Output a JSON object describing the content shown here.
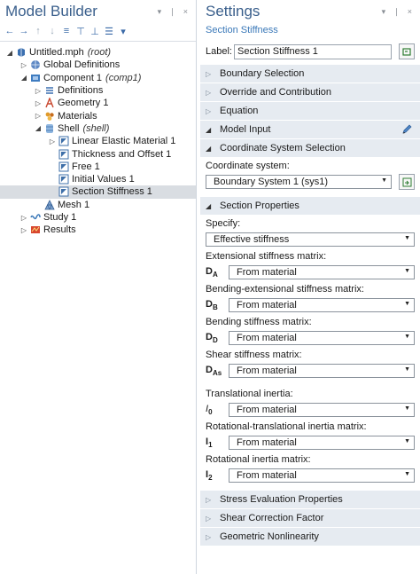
{
  "model_builder": {
    "title": "Model Builder",
    "window_controls": "▾ ❘ ×",
    "toolbar": [
      {
        "name": "back-icon",
        "glyph": "←"
      },
      {
        "name": "forward-icon",
        "glyph": "→"
      },
      {
        "name": "move-up-icon",
        "glyph": "↑"
      },
      {
        "name": "move-down-icon",
        "glyph": "↓"
      },
      {
        "name": "show-icon",
        "glyph": "≡"
      },
      {
        "name": "collapse-icon",
        "glyph": "⊤"
      },
      {
        "name": "expand-icon",
        "glyph": "⊥"
      },
      {
        "name": "list-icon",
        "glyph": "☰"
      },
      {
        "name": "menu-dropdown-icon",
        "glyph": "▾"
      }
    ],
    "tree": [
      {
        "label": "Untitled.mph",
        "em": "(root)",
        "indent": 0,
        "toggle": "◢",
        "icon": "root"
      },
      {
        "label": "Global Definitions",
        "em": "",
        "indent": 1,
        "toggle": "▷",
        "icon": "globe"
      },
      {
        "label": "Component 1",
        "em": "(comp1)",
        "indent": 1,
        "toggle": "◢",
        "icon": "component"
      },
      {
        "label": "Definitions",
        "em": "",
        "indent": 2,
        "toggle": "▷",
        "icon": "definitions"
      },
      {
        "label": "Geometry 1",
        "em": "",
        "indent": 2,
        "toggle": "▷",
        "icon": "geometry"
      },
      {
        "label": "Materials",
        "em": "",
        "indent": 2,
        "toggle": "▷",
        "icon": "materials"
      },
      {
        "label": "Shell",
        "em": "(shell)",
        "indent": 2,
        "toggle": "◢",
        "icon": "shell"
      },
      {
        "label": "Linear Elastic Material 1",
        "em": "",
        "indent": 3,
        "toggle": "▷",
        "icon": "feature"
      },
      {
        "label": "Thickness and Offset 1",
        "em": "",
        "indent": 3,
        "toggle": "",
        "icon": "feature"
      },
      {
        "label": "Free 1",
        "em": "",
        "indent": 3,
        "toggle": "",
        "icon": "feature"
      },
      {
        "label": "Initial Values 1",
        "em": "",
        "indent": 3,
        "toggle": "",
        "icon": "feature"
      },
      {
        "label": "Section Stiffness 1",
        "em": "",
        "indent": 3,
        "toggle": "",
        "icon": "feature",
        "selected": true
      },
      {
        "label": "Mesh 1",
        "em": "",
        "indent": 2,
        "toggle": "",
        "icon": "mesh"
      },
      {
        "label": "Study 1",
        "em": "",
        "indent": 1,
        "toggle": "▷",
        "icon": "study"
      },
      {
        "label": "Results",
        "em": "",
        "indent": 1,
        "toggle": "▷",
        "icon": "results"
      }
    ]
  },
  "settings": {
    "title": "Settings",
    "window_controls": "▾ ❘ ×",
    "subtitle": "Section Stiffness",
    "label_caption": "Label:",
    "label_value": "Section Stiffness 1",
    "sections_top": [
      {
        "title": "Boundary Selection",
        "open": false
      },
      {
        "title": "Override and Contribution",
        "open": false
      },
      {
        "title": "Equation",
        "open": false
      },
      {
        "title": "Model Input",
        "open": true
      }
    ],
    "coord_section": "Coordinate System Selection",
    "coord_label": "Coordinate system:",
    "coord_value": "Boundary System 1 (sys1)",
    "props_section": "Section Properties",
    "specify_label": "Specify:",
    "specify_value": "Effective stiffness",
    "fields": [
      {
        "label": "Extensional stiffness matrix:",
        "sym": "D",
        "sub": "A",
        "value": "From material"
      },
      {
        "label": "Bending-extensional stiffness matrix:",
        "sym": "D",
        "sub": "B",
        "value": "From material"
      },
      {
        "label": "Bending stiffness matrix:",
        "sym": "D",
        "sub": "D",
        "value": "From material"
      },
      {
        "label": "Shear stiffness matrix:",
        "sym": "D",
        "sub": "As",
        "value": "From material"
      },
      {
        "label": "Translational inertia:",
        "sym": "I",
        "sub": "0",
        "value": "From material",
        "italic": true
      },
      {
        "label": "Rotational-translational inertia matrix:",
        "sym": "I",
        "sub": "1",
        "value": "From material"
      },
      {
        "label": "Rotational inertia matrix:",
        "sym": "I",
        "sub": "2",
        "value": "From material"
      }
    ],
    "sections_bottom": [
      {
        "title": "Stress Evaluation Properties",
        "open": false
      },
      {
        "title": "Shear Correction Factor",
        "open": false
      },
      {
        "title": "Geometric Nonlinearity",
        "open": false
      }
    ]
  }
}
